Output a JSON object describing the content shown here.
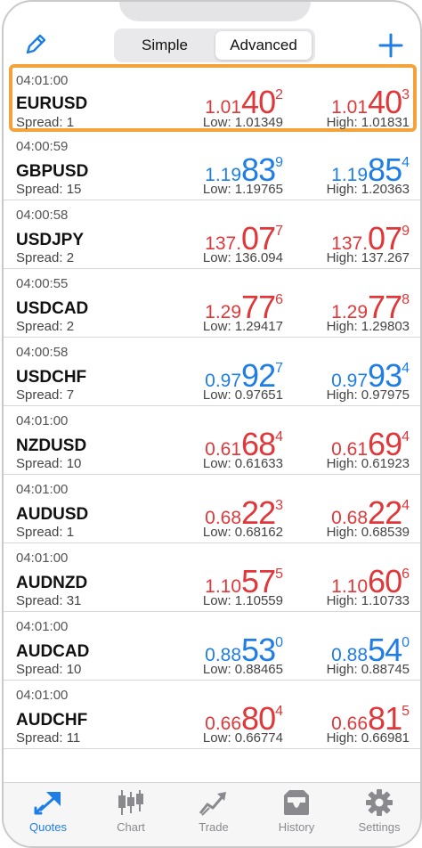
{
  "header": {
    "segments": [
      "Simple",
      "Advanced"
    ],
    "active_segment": "Advanced"
  },
  "colors": {
    "up": "#1f7ee6",
    "down": "#e0383a",
    "highlight": "#f4a23a"
  },
  "quotes": [
    {
      "time": "04:01:00",
      "symbol": "EURUSD",
      "spread": "Spread: 1",
      "color": "red",
      "bid": {
        "a": "1.01",
        "b": "40",
        "c": "2"
      },
      "ask": {
        "a": "1.01",
        "b": "40",
        "c": "3"
      },
      "low": "Low: 1.01349",
      "high": "High: 1.01831",
      "selected": true
    },
    {
      "time": "04:00:59",
      "symbol": "GBPUSD",
      "spread": "Spread: 15",
      "color": "blue",
      "bid": {
        "a": "1.19",
        "b": "83",
        "c": "9"
      },
      "ask": {
        "a": "1.19",
        "b": "85",
        "c": "4"
      },
      "low": "Low: 1.19765",
      "high": "High: 1.20363"
    },
    {
      "time": "04:00:58",
      "symbol": "USDJPY",
      "spread": "Spread: 2",
      "color": "red",
      "bid": {
        "a": "137.",
        "b": "07",
        "c": "7"
      },
      "ask": {
        "a": "137.",
        "b": "07",
        "c": "9"
      },
      "low": "Low: 136.094",
      "high": "High: 137.267"
    },
    {
      "time": "04:00:55",
      "symbol": "USDCAD",
      "spread": "Spread: 2",
      "color": "red",
      "bid": {
        "a": "1.29",
        "b": "77",
        "c": "6"
      },
      "ask": {
        "a": "1.29",
        "b": "77",
        "c": "8"
      },
      "low": "Low: 1.29417",
      "high": "High: 1.29803"
    },
    {
      "time": "04:00:58",
      "symbol": "USDCHF",
      "spread": "Spread: 7",
      "color": "blue",
      "bid": {
        "a": "0.97",
        "b": "92",
        "c": "7"
      },
      "ask": {
        "a": "0.97",
        "b": "93",
        "c": "4"
      },
      "low": "Low: 0.97651",
      "high": "High: 0.97975"
    },
    {
      "time": "04:01:00",
      "symbol": "NZDUSD",
      "spread": "Spread: 10",
      "color": "red",
      "bid": {
        "a": "0.61",
        "b": "68",
        "c": "4"
      },
      "ask": {
        "a": "0.61",
        "b": "69",
        "c": "4"
      },
      "low": "Low: 0.61633",
      "high": "High: 0.61923"
    },
    {
      "time": "04:01:00",
      "symbol": "AUDUSD",
      "spread": "Spread: 1",
      "color": "red",
      "bid": {
        "a": "0.68",
        "b": "22",
        "c": "3"
      },
      "ask": {
        "a": "0.68",
        "b": "22",
        "c": "4"
      },
      "low": "Low: 0.68162",
      "high": "High: 0.68539"
    },
    {
      "time": "04:01:00",
      "symbol": "AUDNZD",
      "spread": "Spread: 31",
      "color": "red",
      "bid": {
        "a": "1.10",
        "b": "57",
        "c": "5"
      },
      "ask": {
        "a": "1.10",
        "b": "60",
        "c": "6"
      },
      "low": "Low: 1.10559",
      "high": "High: 1.10733"
    },
    {
      "time": "04:01:00",
      "symbol": "AUDCAD",
      "spread": "Spread: 10",
      "color": "blue",
      "bid": {
        "a": "0.88",
        "b": "53",
        "c": "0"
      },
      "ask": {
        "a": "0.88",
        "b": "54",
        "c": "0"
      },
      "low": "Low: 0.88465",
      "high": "High: 0.88745"
    },
    {
      "time": "04:01:00",
      "symbol": "AUDCHF",
      "spread": "Spread: 11",
      "color": "red",
      "bid": {
        "a": "0.66",
        "b": "80",
        "c": "4"
      },
      "ask": {
        "a": "0.66",
        "b": "81",
        "c": "5"
      },
      "low": "Low: 0.66774",
      "high": "High: 0.66981"
    }
  ],
  "tabs": [
    {
      "label": "Quotes",
      "icon": "quotes-icon",
      "active": true
    },
    {
      "label": "Chart",
      "icon": "chart-icon"
    },
    {
      "label": "Trade",
      "icon": "trade-icon"
    },
    {
      "label": "History",
      "icon": "history-icon"
    },
    {
      "label": "Settings",
      "icon": "settings-icon"
    }
  ]
}
